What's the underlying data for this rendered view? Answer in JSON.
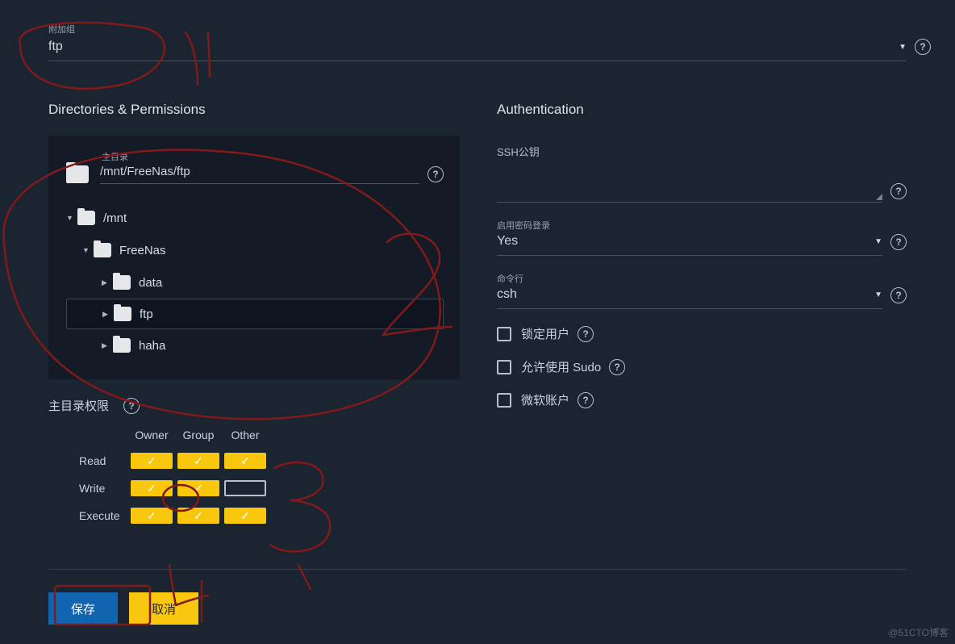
{
  "aux_group": {
    "label": "附加组",
    "value": "ftp"
  },
  "section_left_title": "Directories & Permissions",
  "section_right_title": "Authentication",
  "home_dir": {
    "label": "主目录",
    "value": "/mnt/FreeNas/ftp"
  },
  "tree": {
    "root": "/mnt",
    "child_1": "FreeNas",
    "grandchildren": [
      "data",
      "ftp",
      "haha"
    ]
  },
  "permissions": {
    "title": "主目录权限",
    "headers": [
      "Owner",
      "Group",
      "Other"
    ],
    "rows": [
      {
        "label": "Read",
        "cells": [
          true,
          true,
          true
        ]
      },
      {
        "label": "Write",
        "cells": [
          true,
          true,
          false
        ]
      },
      {
        "label": "Execute",
        "cells": [
          true,
          true,
          true
        ]
      }
    ]
  },
  "auth": {
    "ssh_label": "SSH公钥",
    "password_login": {
      "label": "启用密码登录",
      "value": "Yes"
    },
    "shell": {
      "label": "命令行",
      "value": "csh"
    },
    "checkboxes": [
      {
        "label": "锁定用户"
      },
      {
        "label": "允许使用 Sudo"
      },
      {
        "label": "微软账户"
      }
    ]
  },
  "buttons": {
    "save": "保存",
    "cancel": "取消"
  },
  "watermark": "@51CTO博客"
}
